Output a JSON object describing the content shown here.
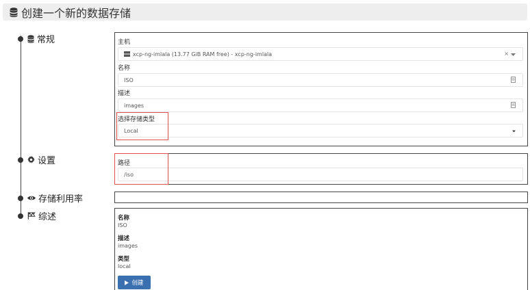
{
  "header": {
    "title": "创建一个新的数据存储",
    "icon": "database-icon"
  },
  "steps": [
    {
      "label": "常规",
      "icon": "database-icon"
    },
    {
      "label": "设置",
      "icon": "gear-icon"
    },
    {
      "label": "存储利用率",
      "icon": "eye-icon"
    },
    {
      "label": "综述",
      "icon": "flag-icon"
    }
  ],
  "general": {
    "host_label": "主机",
    "host_value": "xcp-ng-imlala (13.77 GiB RAM free) - xcp-ng-imlala",
    "host_clear": "×",
    "name_label": "名称",
    "name_value": "ISO",
    "desc_label": "描述",
    "desc_value": "images",
    "type_label": "选择存储类型",
    "type_value": "Local"
  },
  "settings": {
    "path_label": "路径",
    "path_value": "/iso"
  },
  "summary": {
    "name_label": "名称",
    "name_value": "ISO",
    "desc_label": "描述",
    "desc_value": "images",
    "type_label": "类型",
    "type_value": "local",
    "create_label": "创建"
  }
}
